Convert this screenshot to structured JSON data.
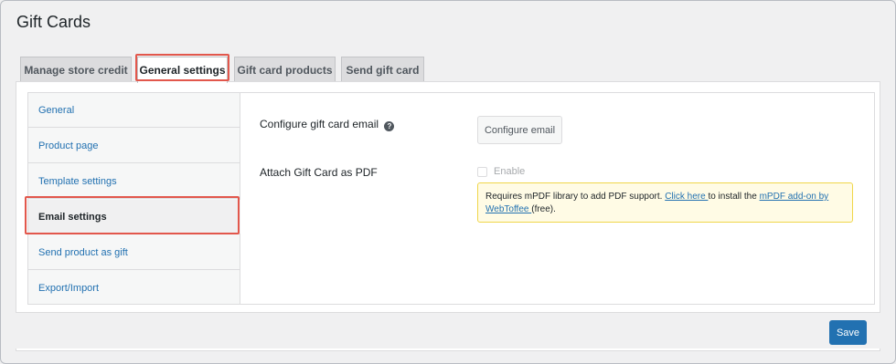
{
  "page": {
    "title": "Gift Cards"
  },
  "tabs": [
    {
      "label": "Manage store credit"
    },
    {
      "label": "General settings"
    },
    {
      "label": "Gift card products"
    },
    {
      "label": "Send gift card"
    }
  ],
  "sidebar": {
    "items": [
      {
        "label": "General"
      },
      {
        "label": "Product page"
      },
      {
        "label": "Template settings"
      },
      {
        "label": "Email settings"
      },
      {
        "label": "Send product as gift"
      },
      {
        "label": "Export/Import"
      }
    ]
  },
  "settings": {
    "configure_email_label": "Configure gift card email",
    "configure_email_button": "Configure email",
    "help_icon": "question-circle-icon",
    "attach_pdf_label": "Attach Gift Card as PDF",
    "enable_label": "Enable",
    "notice": {
      "text_before": "Requires mPDF library to add PDF support. ",
      "link1": "Click here ",
      "text_middle": "to install the ",
      "link2": "mPDF add-on by WebToffee ",
      "text_after": "(free)."
    }
  },
  "footer": {
    "save_label": "Save"
  },
  "colors": {
    "accent": "#2271b1",
    "highlight": "#e2574c",
    "notice_bg": "#fffbe5",
    "notice_border": "#f0d64a"
  }
}
